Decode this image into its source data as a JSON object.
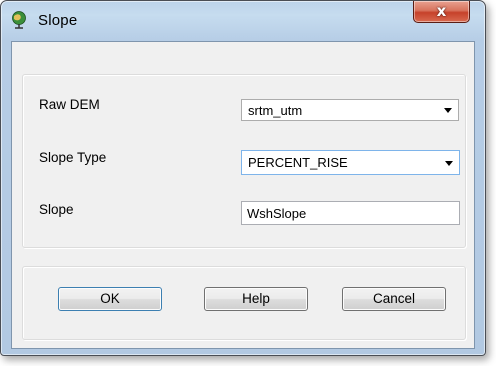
{
  "window": {
    "title": "Slope",
    "title_icon": "globe-gis-icon",
    "close_glyph": "x"
  },
  "form": {
    "raw_dem": {
      "label": "Raw DEM",
      "value": "srtm_utm"
    },
    "slope_type": {
      "label": "Slope Type",
      "value": "PERCENT_RISE"
    },
    "slope": {
      "label": "Slope",
      "value": "WshSlope"
    }
  },
  "buttons": {
    "ok": "OK",
    "help": "Help",
    "cancel": "Cancel"
  },
  "colors": {
    "frame": "#b6cde6",
    "close_red": "#c6412a",
    "client": "#f0f0f0",
    "focus_border": "#7eb4ea"
  }
}
